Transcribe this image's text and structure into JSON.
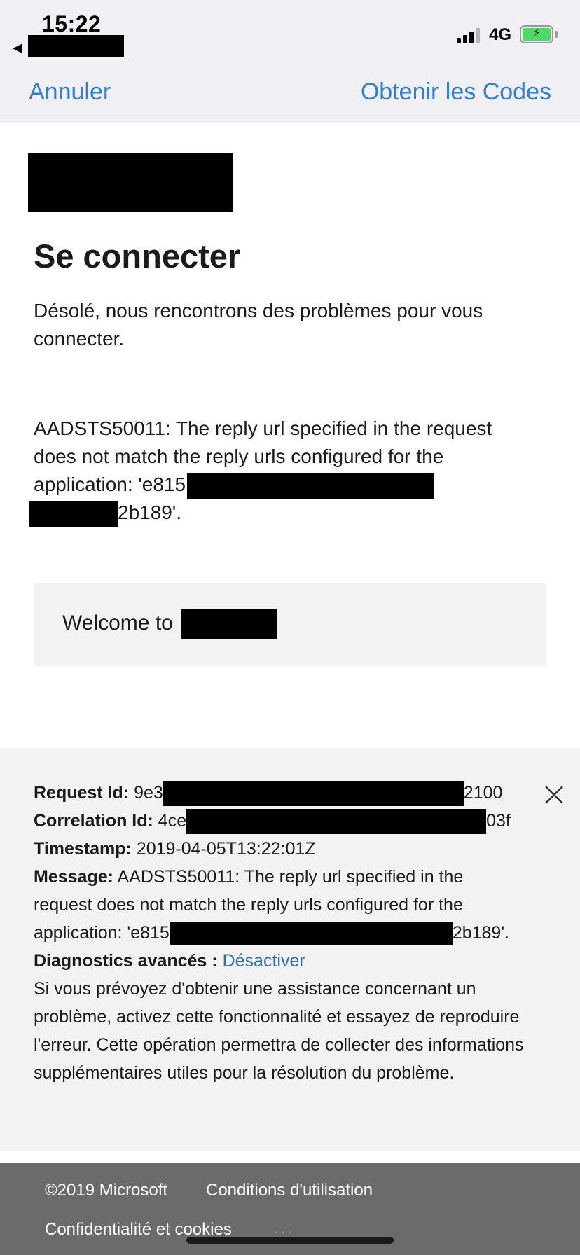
{
  "status_bar": {
    "time": "15:22",
    "network": "4G",
    "back_arrow": "◀"
  },
  "nav": {
    "cancel_label": "Annuler",
    "get_codes_label": "Obtenir les Codes"
  },
  "main": {
    "title": "Se connecter",
    "description": "Désolé, nous rencontrons des problèmes pour vous connecter.",
    "error_line1": "AADSTS50011: The reply url specified in the request",
    "error_line2": "does not match the reply urls configured for the",
    "error_line3_prefix": "application: 'e815",
    "error_line4_suffix": "2b189'.",
    "welcome_text": "Welcome to"
  },
  "diagnostics": {
    "request_id_label": "Request Id:",
    "request_id_prefix": "9e3",
    "request_id_suffix": "2100",
    "correlation_id_label": "Correlation Id:",
    "correlation_id_prefix": "4ce",
    "correlation_id_suffix": "03f",
    "timestamp_label": "Timestamp:",
    "timestamp_value": "2019-04-05T13:22:01Z",
    "message_label": "Message:",
    "message_line1": "AADSTS50011: The reply url specified in the",
    "message_line2": "request does not match the reply urls configured for the",
    "message_line3_prefix": "application: 'e815",
    "message_line3_suffix": "2b189'.",
    "advanced_label": "Diagnostics avancés :",
    "advanced_link": "Désactiver",
    "help_text": "Si vous prévoyez d'obtenir une assistance concernant un problème, activez cette fonctionnalité et essayez de reproduire l'erreur. Cette opération permettra de collecter des informations supplémentaires utiles pour la résolution du problème."
  },
  "footer": {
    "copyright": "©2019 Microsoft",
    "terms": "Conditions d'utilisation",
    "privacy": "Confidentialité et cookies",
    "more": "..."
  },
  "colors": {
    "link_blue": "#2f7de1",
    "diag_link": "#2f6fb8",
    "footer_bg": "#6b6b6b",
    "battery_green": "#4cd964"
  }
}
